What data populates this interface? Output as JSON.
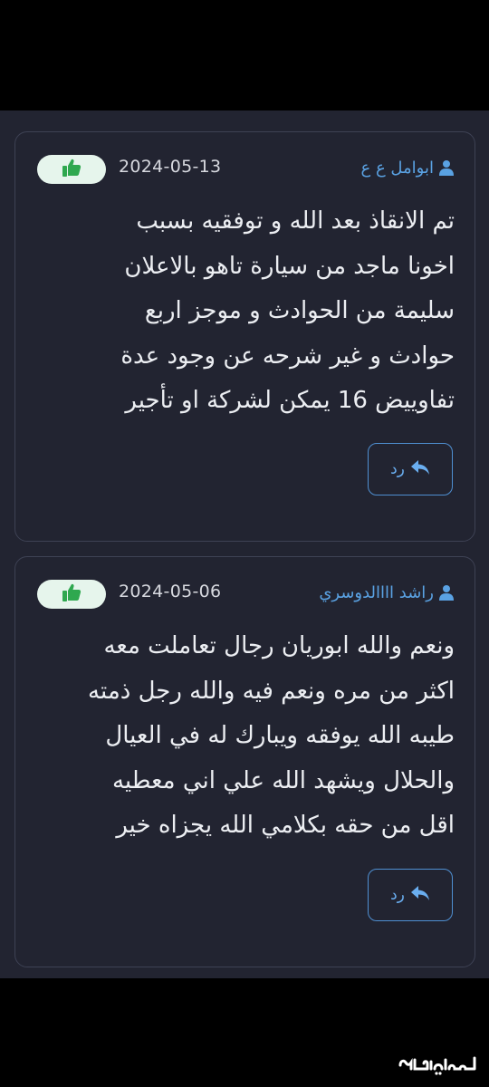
{
  "comments": [
    {
      "author": "ابوامل ع ع",
      "date": "2024-05-13",
      "text": "تم الانقاذ بعد الله و توفقيه بسبب\nاخونا ماجد من سيارة تاهو بالاعلان\nسليمة من الحوادث و موجز اربع\nحوادث و غير شرحه عن وجود عدة\nتفاوييض 16 يمكن لشركة او تأجير",
      "reply_label": "رد"
    },
    {
      "author": "راشد اااالدوسري",
      "date": "2024-05-06",
      "text": "ونعم والله ابوريان رجال تعاملت معه\nاكثر من مره ونعم فيه والله رجل ذمته\nطيبه الله يوفقه ويبارك له في العيال\nوالحلال ويشهد الله علي اني معطيه\nاقل من حقه بكلامي الله يجزاه خير",
      "reply_label": "رد"
    }
  ],
  "icons": {
    "author": "user-icon",
    "like": "thumbs-up-icon",
    "reply": "reply-arrow-icon"
  },
  "colors": {
    "panel_bg": "#222431",
    "author": "#5aa2e3",
    "like_icon": "#2fa84f",
    "reply_border": "#4f8fd1"
  },
  "watermark": {
    "text": "مستعمل"
  }
}
